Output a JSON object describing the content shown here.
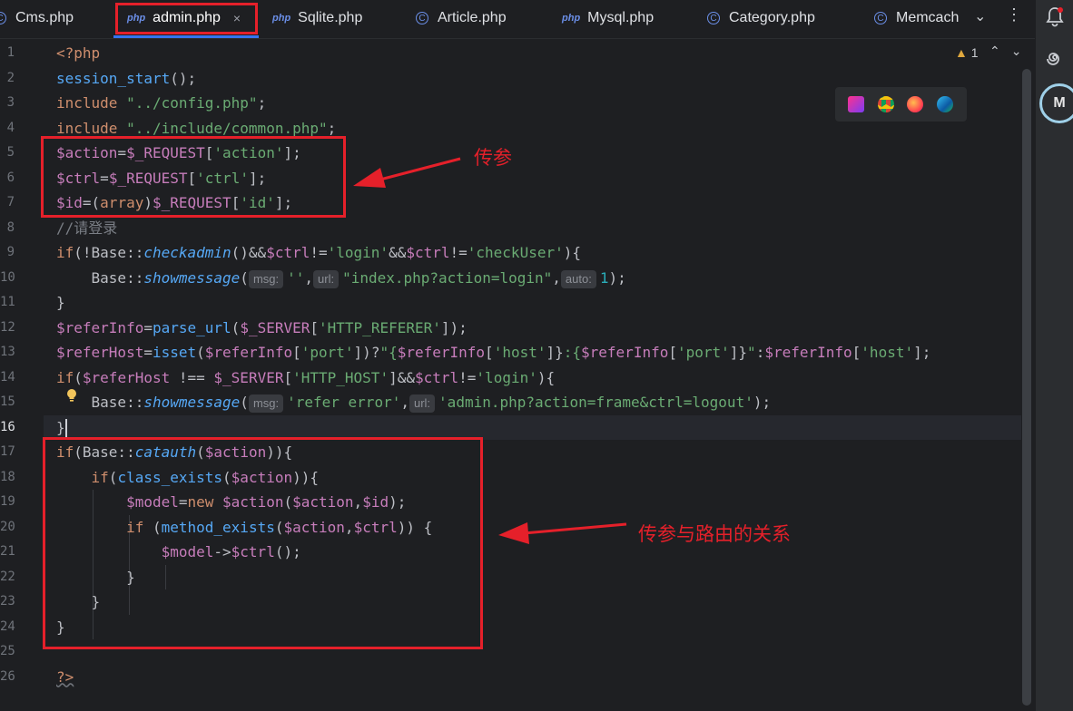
{
  "tabs": [
    {
      "label": "Cms.php",
      "type": "class"
    },
    {
      "label": "admin.php",
      "type": "php",
      "active": true
    },
    {
      "label": "Sqlite.php",
      "type": "php"
    },
    {
      "label": "Article.php",
      "type": "class"
    },
    {
      "label": "Mysql.php",
      "type": "php"
    },
    {
      "label": "Category.php",
      "type": "class"
    },
    {
      "label": "Memcach",
      "type": "class"
    }
  ],
  "php_badge": "php",
  "close_icon": "×",
  "warnings": {
    "count": "1"
  },
  "annotations": {
    "params": "传参",
    "routing": "传参与路由的关系"
  },
  "line_numbers": [
    "1",
    "2",
    "3",
    "4",
    "5",
    "6",
    "7",
    "8",
    "9",
    "10",
    "11",
    "12",
    "13",
    "14",
    "15",
    "16",
    "17",
    "18",
    "19",
    "20",
    "21",
    "22",
    "23",
    "24",
    "25",
    "26"
  ],
  "code": {
    "l1": "<?php",
    "l2_fn": "session_start",
    "l2_rest": "();",
    "l3_kw": "include ",
    "l3_str": "\"../config.php\"",
    "l3_end": ";",
    "l4_kw": "include ",
    "l4_str": "\"../include/common.php\"",
    "l4_end": ";",
    "l5_var": "$action",
    "l5_eq": "=",
    "l5_var2": "$_REQUEST",
    "l5_b1": "[",
    "l5_str": "'action'",
    "l5_b2": "];",
    "l6_var": "$ctrl",
    "l6_eq": "=",
    "l6_var2": "$_REQUEST",
    "l6_b1": "[",
    "l6_str": "'ctrl'",
    "l6_b2": "];",
    "l7_var": "$id",
    "l7_eq": "=(",
    "l7_kw": "array",
    "l7_cl": ")",
    "l7_var2": "$_REQUEST",
    "l7_b1": "[",
    "l7_str": "'id'",
    "l7_b2": "];",
    "l8": "//请登录",
    "l9_kw": "if",
    "l9_a": "(!Base::",
    "l9_fn": "checkadmin",
    "l9_b": "()&&",
    "l9_var": "$ctrl",
    "l9_c": "!=",
    "l9_str": "'login'",
    "l9_d": "&&",
    "l9_var2": "$ctrl",
    "l9_e": "!=",
    "l9_str2": "'checkUser'",
    "l9_f": "){",
    "l10_a": "    Base::",
    "l10_fn": "showmessage",
    "l10_b": "(",
    "l10_h1": "msg:",
    "l10_str1": "''",
    "l10_c": ",",
    "l10_h2": "url:",
    "l10_str2": "\"index.php?action=login\"",
    "l10_d": ",",
    "l10_h3": "auto:",
    "l10_num": "1",
    "l10_e": ");",
    "l11": "}",
    "l12_var": "$referInfo",
    "l12_a": "=",
    "l12_fn": "parse_url",
    "l12_b": "(",
    "l12_var2": "$_SERVER",
    "l12_c": "[",
    "l12_str": "'HTTP_REFERER'",
    "l12_d": "]);",
    "l13_var": "$referHost",
    "l13_a": "=",
    "l13_fn": "isset",
    "l13_b": "(",
    "l13_var2": "$referInfo",
    "l13_c": "[",
    "l13_str1": "'port'",
    "l13_d": "])?",
    "l13_q1": "\"{",
    "l13_var3": "$referInfo",
    "l13_e": "[",
    "l13_str2": "'host'",
    "l13_f": "]}",
    "l13_q2": ":{",
    "l13_var4": "$referInfo",
    "l13_g": "[",
    "l13_str3": "'port'",
    "l13_h": "]}",
    "l13_q3": "\"",
    "l13_i": ":",
    "l13_var5": "$referInfo",
    "l13_j": "[",
    "l13_str4": "'host'",
    "l13_k": "];",
    "l14_kw": "if",
    "l14_a": "(",
    "l14_var": "$referHost",
    "l14_b": " !== ",
    "l14_var2": "$_SERVER",
    "l14_c": "[",
    "l14_str": "'HTTP_HOST'",
    "l14_d": "]&&",
    "l14_var3": "$ctrl",
    "l14_e": "!=",
    "l14_str2": "'login'",
    "l14_f": "){",
    "l15_a": "    Base::",
    "l15_fn": "showmessage",
    "l15_b": "(",
    "l15_h1": "msg:",
    "l15_str1": "'refer error'",
    "l15_c": ",",
    "l15_h2": "url:",
    "l15_str2": "'admin.php?action=frame&ctrl=logout'",
    "l15_d": ");",
    "l16": "}",
    "l17_kw": "if",
    "l17_a": "(Base::",
    "l17_fn": "catauth",
    "l17_b": "(",
    "l17_var": "$action",
    "l17_c": ")){",
    "l18_kw": "    if",
    "l18_a": "(",
    "l18_fn": "class_exists",
    "l18_b": "(",
    "l18_var": "$action",
    "l18_c": ")){",
    "l19_var": "        $model",
    "l19_a": "=",
    "l19_kw": "new ",
    "l19_var2": "$action",
    "l19_b": "(",
    "l19_var3": "$action",
    "l19_c": ",",
    "l19_var4": "$id",
    "l19_d": ");",
    "l20_kw": "        if ",
    "l20_a": "(",
    "l20_fn": "method_exists",
    "l20_b": "(",
    "l20_var": "$action",
    "l20_c": ",",
    "l20_var2": "$ctrl",
    "l20_d": ")) {",
    "l21_var": "            $model",
    "l21_a": "->",
    "l21_var2": "$ctrl",
    "l21_b": "();",
    "l22": "        }",
    "l23": "    }",
    "l24": "}",
    "l26": "?>"
  },
  "colors": {
    "highlight_box": "#e5202a",
    "keyword": "#cf8e6d",
    "function": "#56a8f5",
    "variable": "#c77dbb",
    "string": "#6aab73",
    "number": "#2aacb8"
  },
  "icons": [
    "phpstorm-icon",
    "chrome-icon",
    "firefox-icon",
    "edge-icon",
    "bell-icon",
    "spiral-icon",
    "avatar-icon",
    "lightbulb-icon"
  ]
}
